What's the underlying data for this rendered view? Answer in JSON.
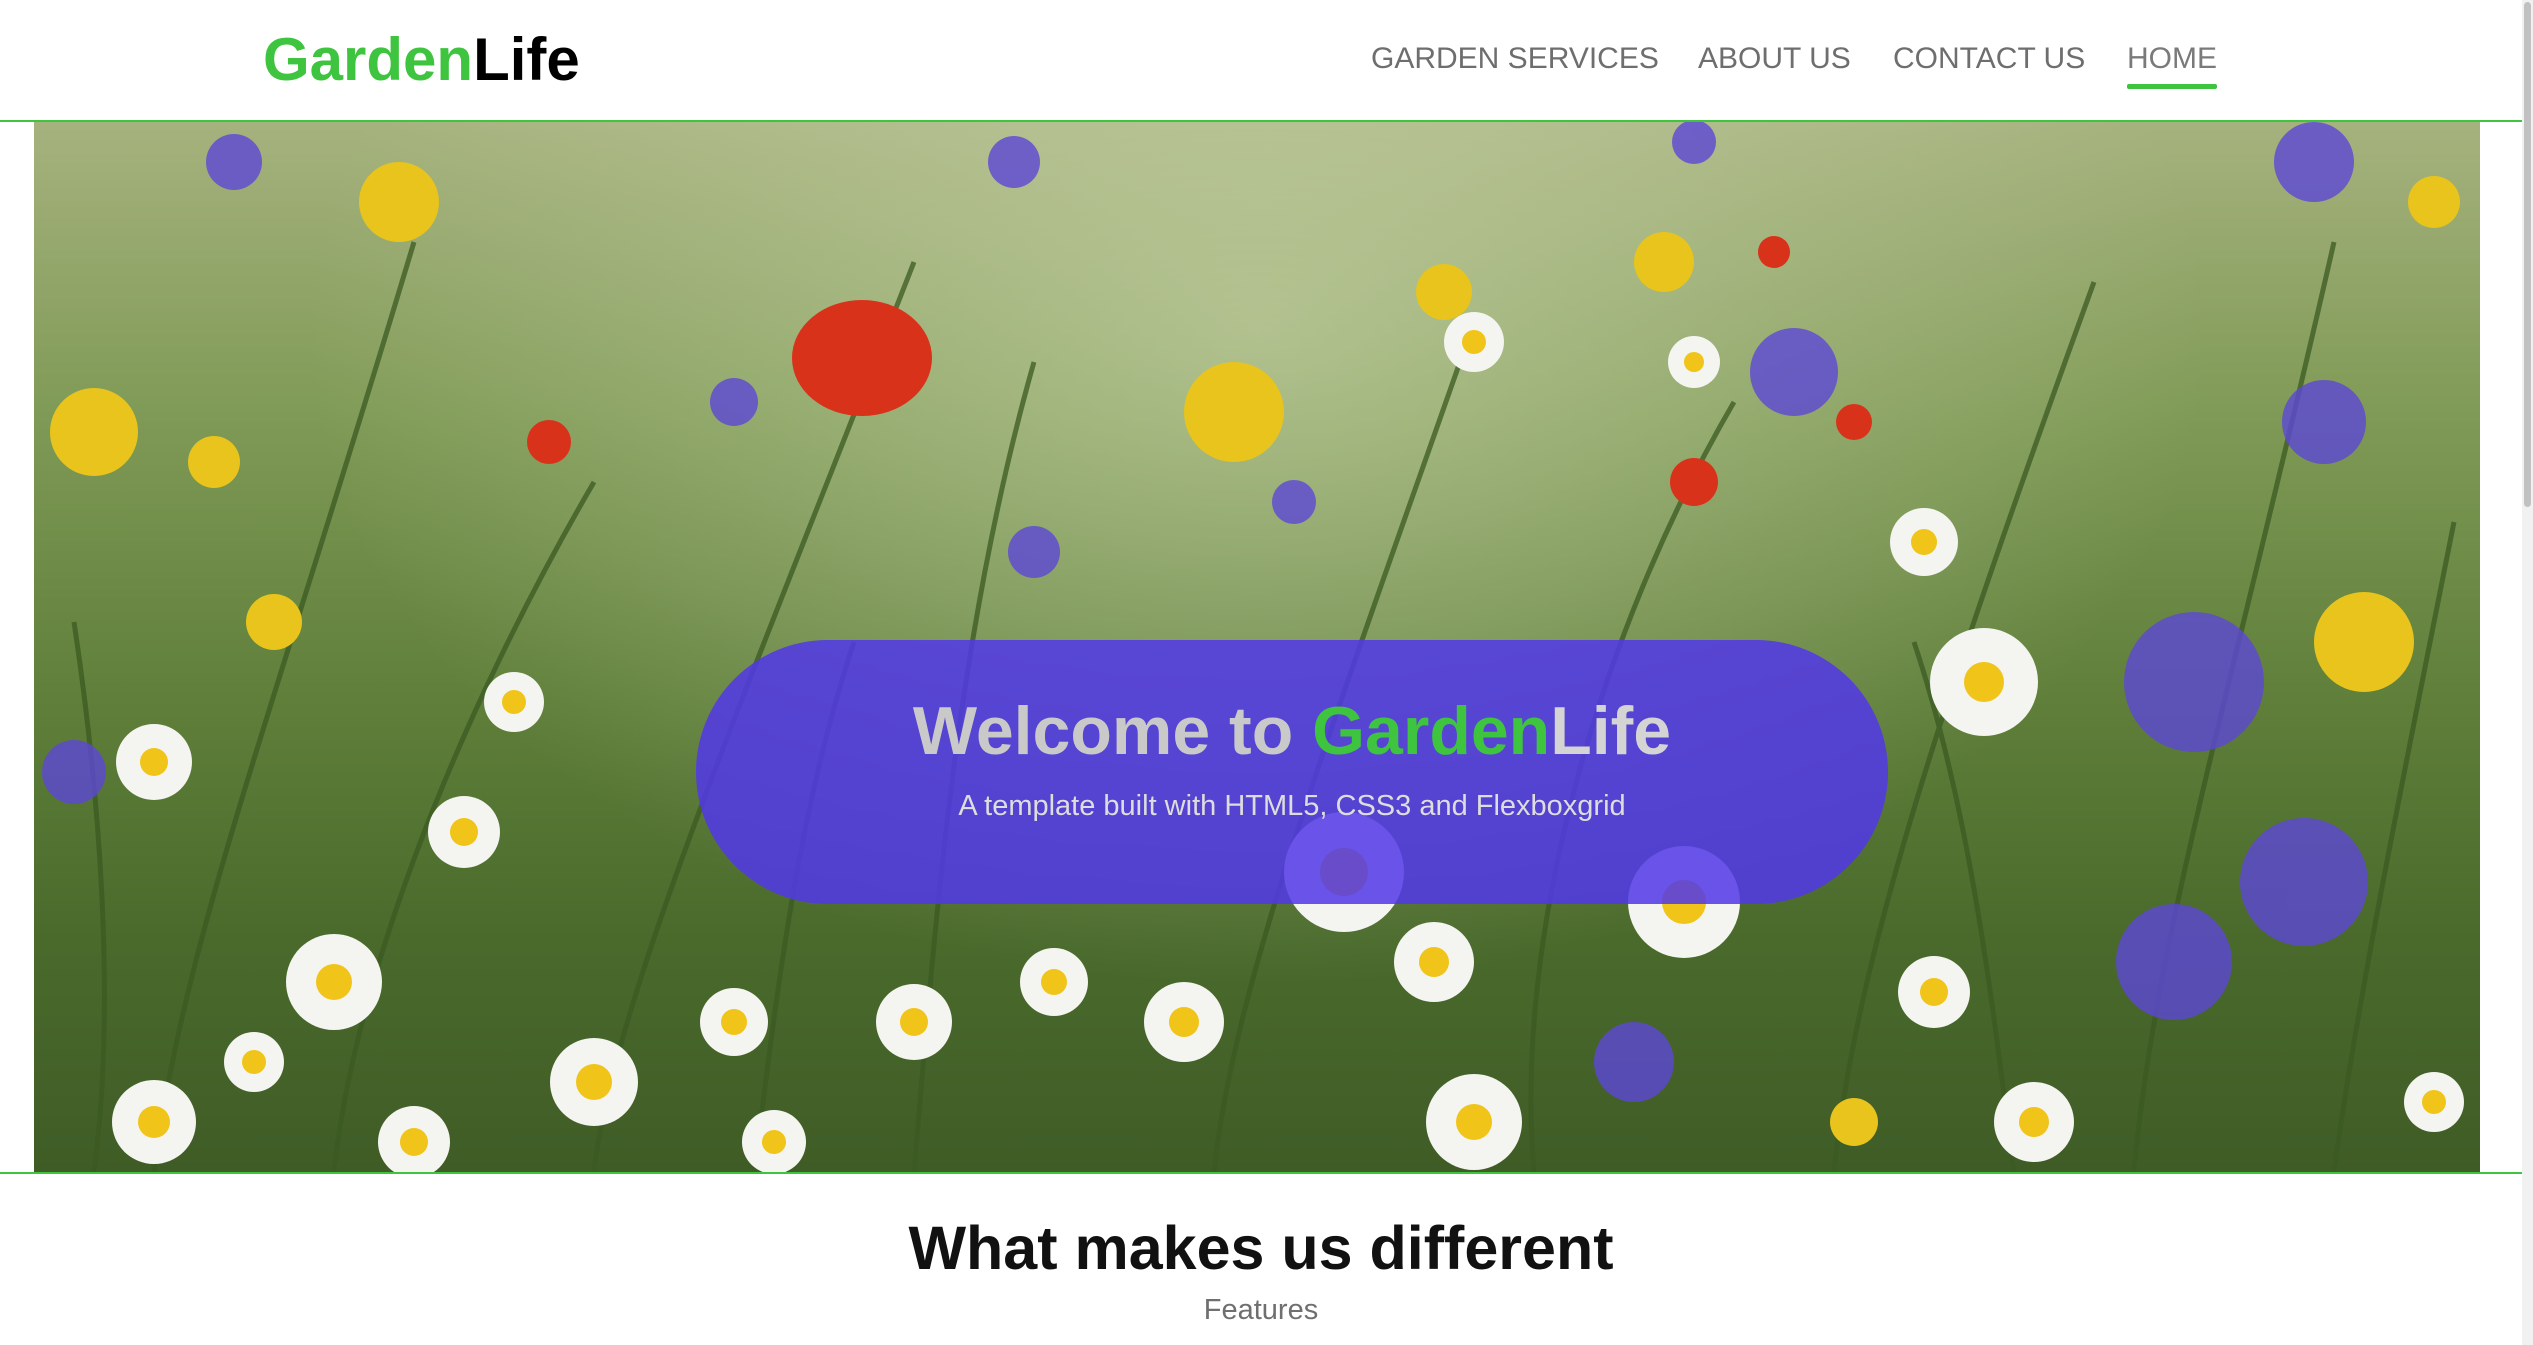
{
  "brand": {
    "part1": "Garden",
    "part2": "Life",
    "green": "#3fc43f"
  },
  "nav": {
    "items": [
      {
        "label": "GARDEN SERVICES"
      },
      {
        "label": "ABOUT US"
      },
      {
        "label": "CONTACT US"
      },
      {
        "label": "HOME",
        "active": true
      }
    ]
  },
  "hero": {
    "image": "wildflower-meadow-photo",
    "title_prefix": "Welcome to ",
    "title_brand_green": "Garden",
    "title_brand_rest": "Life",
    "subtitle": "A template built with HTML5, CSS3 and Flexboxgrid",
    "banner_color": "#5238e8"
  },
  "section": {
    "title": "What makes us different",
    "subtitle": "Features"
  }
}
